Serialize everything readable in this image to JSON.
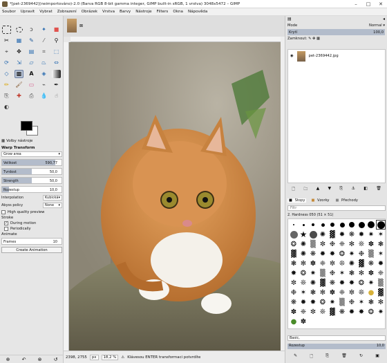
{
  "window": {
    "title": "*[pet-2369442](neimportováno)-2.0 (Barva RGB 8-bit gamma integer, GIMP built-in sRGB, 1 vrstva) 3048x5472 – GIMP"
  },
  "menu": [
    "Soubor",
    "Upravit",
    "Vybrat",
    "Zobrazení",
    "Obrázek",
    "Vrstva",
    "Barvy",
    "Nástroje",
    "Filters",
    "Okna",
    "Nápověda"
  ],
  "tool_options": {
    "tab_label": "Volby nástroje",
    "tool_name": "Warp Transform",
    "mode": "Grow area",
    "sliders": [
      {
        "label": "Velikost",
        "value": "590,77",
        "level": 0.9
      },
      {
        "label": "Tvrdost",
        "value": "50,0",
        "level": 0.5
      },
      {
        "label": "Strength",
        "value": "50,0",
        "level": 0.5
      },
      {
        "label": "Rozestup",
        "value": "10,0",
        "level": 0.12
      }
    ],
    "interpolation_label": "Interpolation",
    "interpolation_value": "Kubická",
    "abyss_label": "Abyss policy",
    "abyss_value": "None",
    "hq_preview": "High quality preview",
    "stroke_label": "Stroke",
    "during_motion": "During motion",
    "periodically": "Periodically",
    "animate_label": "Animate",
    "frames_label": "Frames",
    "frames_value": "10",
    "create_animation": "Create Animation"
  },
  "status": {
    "coords": "2398, 2755",
    "unit": "px",
    "zoom": "18,2 %",
    "message": "Klávesou ENTER transformaci potvrdíte"
  },
  "layers": {
    "mode_label": "Mode",
    "mode_value": "Normal",
    "opacity_label": "Krytí",
    "opacity_value": "100,0",
    "lock_label": "Zamknout:",
    "layer_name": "pet-2369442.jpg"
  },
  "brushes": {
    "tabs": [
      "Stopy",
      "Vzorky",
      "Přechody"
    ],
    "filter_placeholder": "Filtr",
    "brush_name": "2. Hardness 050 (51 × 51)",
    "tag_placeholder": "Basic,",
    "spacing_label": "Rozestup",
    "spacing_value": "10,0"
  }
}
